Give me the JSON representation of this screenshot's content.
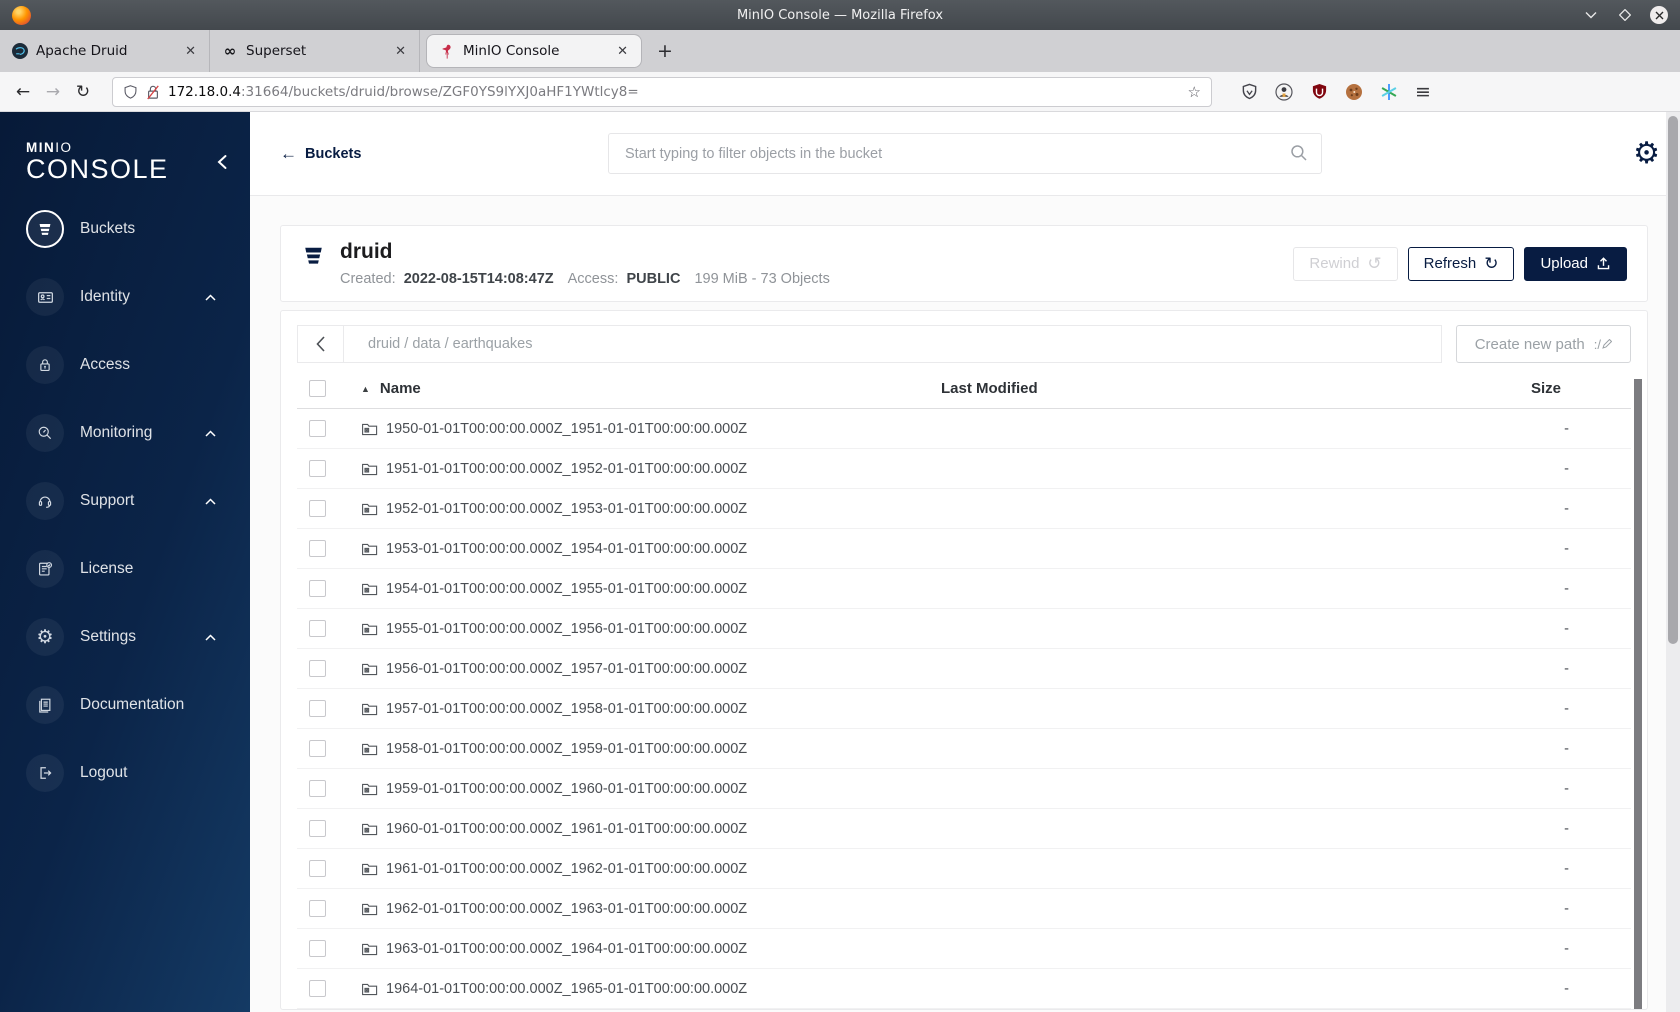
{
  "browser": {
    "window_title": "MinIO Console — Mozilla Firefox",
    "tabs": [
      {
        "label": "Apache Druid"
      },
      {
        "label": "Superset"
      },
      {
        "label": "MinIO Console"
      }
    ],
    "url": {
      "domain": "172.18.0.4",
      "rest": ":31664/buckets/druid/browse/ZGF0YS9lYXJ0aHF1YWtlcy8="
    }
  },
  "icons": {
    "close_tab": "✕",
    "new_tab": "+",
    "back_arrow": "←",
    "forward_arrow": "→",
    "reload": "↻",
    "star": "☆",
    "hamburger": "≡",
    "superset_glyph": "∞",
    "gear": "⚙",
    "sort_asc": "▲",
    "refresh": "↻",
    "rewind": "↺",
    "create_path_glyph": ":/"
  },
  "colors": {
    "accent_navy": "#081C42",
    "flamingo_red": "#C72C48"
  },
  "sidebar": {
    "logo": {
      "brand_bold": "MIN",
      "brand_light": "IO",
      "product": "CONSOLE"
    },
    "items": [
      {
        "label": "Buckets",
        "active": true,
        "expandable": false
      },
      {
        "label": "Identity",
        "active": false,
        "expandable": true
      },
      {
        "label": "Access",
        "active": false,
        "expandable": false
      },
      {
        "label": "Monitoring",
        "active": false,
        "expandable": true
      },
      {
        "label": "Support",
        "active": false,
        "expandable": true
      },
      {
        "label": "License",
        "active": false,
        "expandable": false
      },
      {
        "label": "Settings",
        "active": false,
        "expandable": true
      },
      {
        "label": "Documentation",
        "active": false,
        "expandable": false
      }
    ],
    "logout_label": "Logout"
  },
  "header": {
    "back_label": "Buckets",
    "search_placeholder": "Start typing to filter objects in the bucket"
  },
  "bucket": {
    "name": "druid",
    "created_label": "Created:",
    "created_value": "2022-08-15T14:08:47Z",
    "access_label": "Access:",
    "access_value": "PUBLIC",
    "usage": "199 MiB - 73 Objects",
    "rewind_label": "Rewind",
    "refresh_label": "Refresh",
    "upload_label": "Upload"
  },
  "browse": {
    "breadcrumb": "druid / data / earthquakes",
    "create_path_label": "Create new path",
    "columns": {
      "name": "Name",
      "last_modified": "Last Modified",
      "size": "Size"
    },
    "rows": [
      {
        "name": "1950-01-01T00:00:00.000Z_1951-01-01T00:00:00.000Z",
        "last_modified": "",
        "size": "-"
      },
      {
        "name": "1951-01-01T00:00:00.000Z_1952-01-01T00:00:00.000Z",
        "last_modified": "",
        "size": "-"
      },
      {
        "name": "1952-01-01T00:00:00.000Z_1953-01-01T00:00:00.000Z",
        "last_modified": "",
        "size": "-"
      },
      {
        "name": "1953-01-01T00:00:00.000Z_1954-01-01T00:00:00.000Z",
        "last_modified": "",
        "size": "-"
      },
      {
        "name": "1954-01-01T00:00:00.000Z_1955-01-01T00:00:00.000Z",
        "last_modified": "",
        "size": "-"
      },
      {
        "name": "1955-01-01T00:00:00.000Z_1956-01-01T00:00:00.000Z",
        "last_modified": "",
        "size": "-"
      },
      {
        "name": "1956-01-01T00:00:00.000Z_1957-01-01T00:00:00.000Z",
        "last_modified": "",
        "size": "-"
      },
      {
        "name": "1957-01-01T00:00:00.000Z_1958-01-01T00:00:00.000Z",
        "last_modified": "",
        "size": "-"
      },
      {
        "name": "1958-01-01T00:00:00.000Z_1959-01-01T00:00:00.000Z",
        "last_modified": "",
        "size": "-"
      },
      {
        "name": "1959-01-01T00:00:00.000Z_1960-01-01T00:00:00.000Z",
        "last_modified": "",
        "size": "-"
      },
      {
        "name": "1960-01-01T00:00:00.000Z_1961-01-01T00:00:00.000Z",
        "last_modified": "",
        "size": "-"
      },
      {
        "name": "1961-01-01T00:00:00.000Z_1962-01-01T00:00:00.000Z",
        "last_modified": "",
        "size": "-"
      },
      {
        "name": "1962-01-01T00:00:00.000Z_1963-01-01T00:00:00.000Z",
        "last_modified": "",
        "size": "-"
      },
      {
        "name": "1963-01-01T00:00:00.000Z_1964-01-01T00:00:00.000Z",
        "last_modified": "",
        "size": "-"
      },
      {
        "name": "1964-01-01T00:00:00.000Z_1965-01-01T00:00:00.000Z",
        "last_modified": "",
        "size": "-"
      }
    ]
  }
}
